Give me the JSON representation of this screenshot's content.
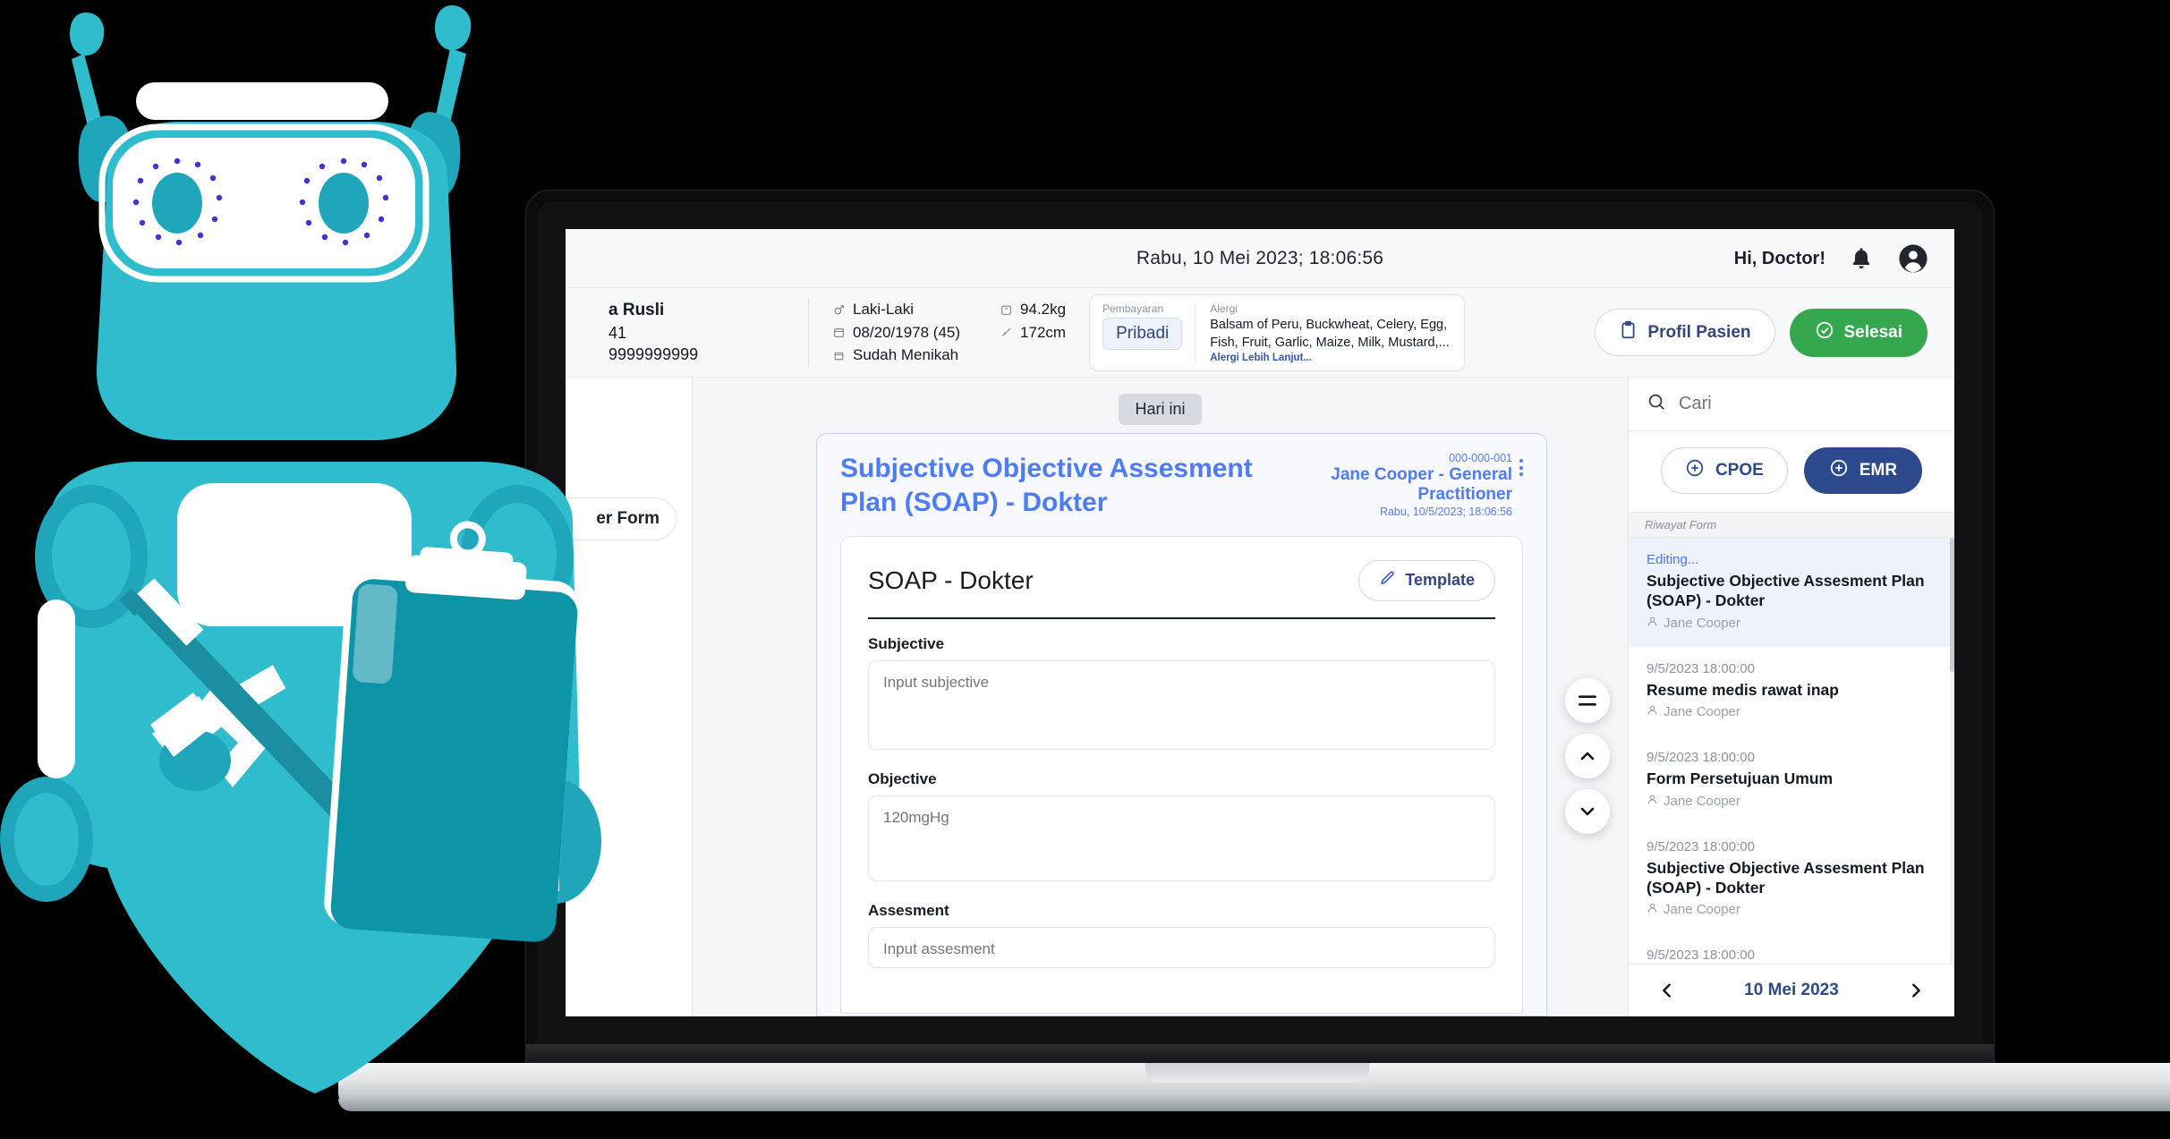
{
  "topbar": {
    "datetime": "Rabu, 10 Mei 2023; 18:06:56",
    "greeting": "Hi, Doctor!",
    "bell_icon": "bell-icon",
    "avatar_icon": "user-avatar-icon"
  },
  "patient": {
    "name": "a Rusli",
    "id": "41",
    "phone": "9999999999",
    "gender": "Laki-Laki",
    "birthdate": "08/20/1978 (45)",
    "marital_status": "Sudah Menikah",
    "weight": "94.2kg",
    "height": "172cm",
    "payment_label": "Pembayaran",
    "payment_value": "Pribadi",
    "allergy_label": "Alergi",
    "allergy_text": "Balsam of Peru, Buckwheat, Celery, Egg, Fish, Fruit, Garlic, Maize, Milk, Mustard,...",
    "allergy_more": "Alergi Lebih Lanjut..."
  },
  "header_actions": {
    "profile_label": "Profil Pasien",
    "profile_icon": "clipboard-icon",
    "done_label": "Selesai",
    "done_icon": "check-circle-icon",
    "done_color": "#35a84f"
  },
  "left_rail": {
    "chip_label": "er Form"
  },
  "main": {
    "today_badge": "Hari ini",
    "form_title": "Subjective Objective Assesment Plan (SOAP) - Dokter",
    "meta_code": "000-000-001",
    "meta_doctor": "Jane Cooper - General Practitioner",
    "meta_time": "Rabu, 10/5/2023; 18:06:56",
    "card_title": "SOAP - Dokter",
    "template_label": "Template",
    "template_icon": "pencil-icon",
    "fields": [
      {
        "label": "Subjective",
        "placeholder": "Input subjective"
      },
      {
        "label": "Objective",
        "placeholder": "120mgHg"
      },
      {
        "label": "Assesment",
        "placeholder": "Input assesment"
      }
    ],
    "fabs": [
      {
        "icon": "hamburger-menu-icon"
      },
      {
        "icon": "chevron-up-icon"
      },
      {
        "icon": "chevron-down-icon"
      }
    ]
  },
  "sidebar": {
    "search_placeholder": "Cari",
    "search_value": "",
    "search_icon": "search-icon",
    "cpoe_label": "CPOE",
    "emr_label": "EMR",
    "plus_icon": "plus-circle-icon",
    "section_label": "Riwayat Form",
    "emr_color": "#2c4a8c",
    "items": [
      {
        "stamp": "Editing...",
        "title": "Subjective Objective Assesment Plan (SOAP) - Dokter",
        "user": "Jane Cooper",
        "active": true
      },
      {
        "stamp": "9/5/2023 18:00:00",
        "title": "Resume medis rawat inap",
        "user": "Jane Cooper",
        "active": false
      },
      {
        "stamp": "9/5/2023 18:00:00",
        "title": "Form Persetujuan Umum",
        "user": "Jane Cooper",
        "active": false
      },
      {
        "stamp": "9/5/2023 18:00:00",
        "title": "Subjective Objective Assesment Plan (SOAP) - Dokter",
        "user": "Jane Cooper",
        "active": false
      },
      {
        "stamp": "9/5/2023 18:00:00",
        "title": "",
        "user": "",
        "active": false
      }
    ],
    "footer": {
      "prev_icon": "chevron-left-icon",
      "date": "10 Mei 2023",
      "next_icon": "chevron-right-icon"
    }
  },
  "mascot": {
    "name": "robot-mascot",
    "body_color": "#2fbdce",
    "accent_color": "#16a2b5",
    "eye_dot_color": "#4a2fd0"
  }
}
